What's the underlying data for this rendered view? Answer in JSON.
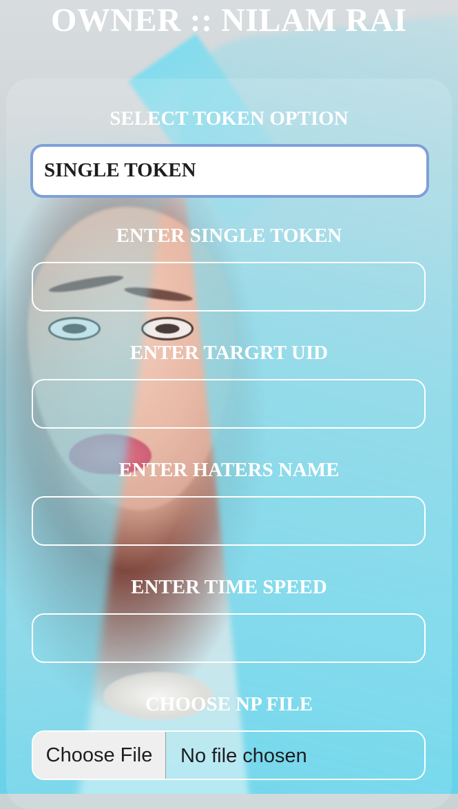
{
  "app": {
    "title": "OWNER :: NILAM RAI"
  },
  "form": {
    "token_option_label": "SELECT TOKEN OPTION",
    "token_option_value": "SINGLE TOKEN",
    "single_token_label": "ENTER SINGLE TOKEN",
    "single_token_value": "",
    "target_uid_label": "ENTER TARGRT UID",
    "target_uid_value": "",
    "haters_name_label": "ENTER HATERS NAME",
    "haters_name_value": "",
    "time_speed_label": "ENTER TIME SPEED",
    "time_speed_value": "",
    "np_file_label": "CHOOSE NP FILE",
    "file_button_label": "Choose File",
    "file_status": "No file chosen"
  }
}
